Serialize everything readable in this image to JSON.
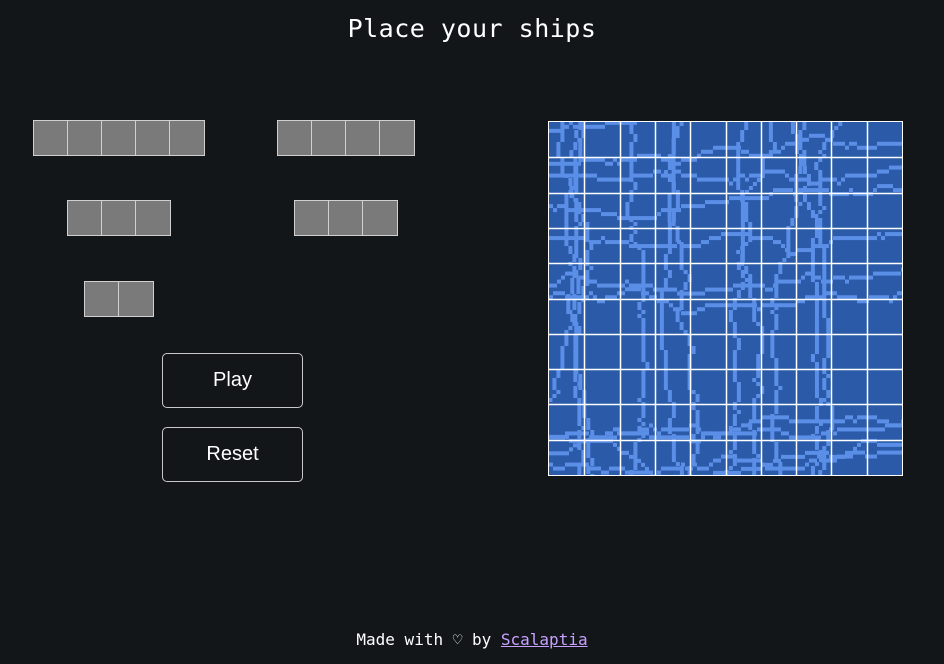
{
  "page": {
    "title": "Place your ships"
  },
  "ships": [
    {
      "name": "ship-5",
      "length": 5
    },
    {
      "name": "ship-4",
      "length": 4
    },
    {
      "name": "ship-3a",
      "length": 3
    },
    {
      "name": "ship-3b",
      "length": 3
    },
    {
      "name": "ship-2",
      "length": 2
    }
  ],
  "buttons": {
    "play": "Play",
    "reset": "Reset"
  },
  "board": {
    "rows": 10,
    "cols": 10,
    "water_dark": "#2b5aa8",
    "water_light": "#5b8ee6",
    "grid_color": "#ffffff"
  },
  "footer": {
    "prefix": "Made with ♡ by",
    "link": "Scalaptia"
  }
}
